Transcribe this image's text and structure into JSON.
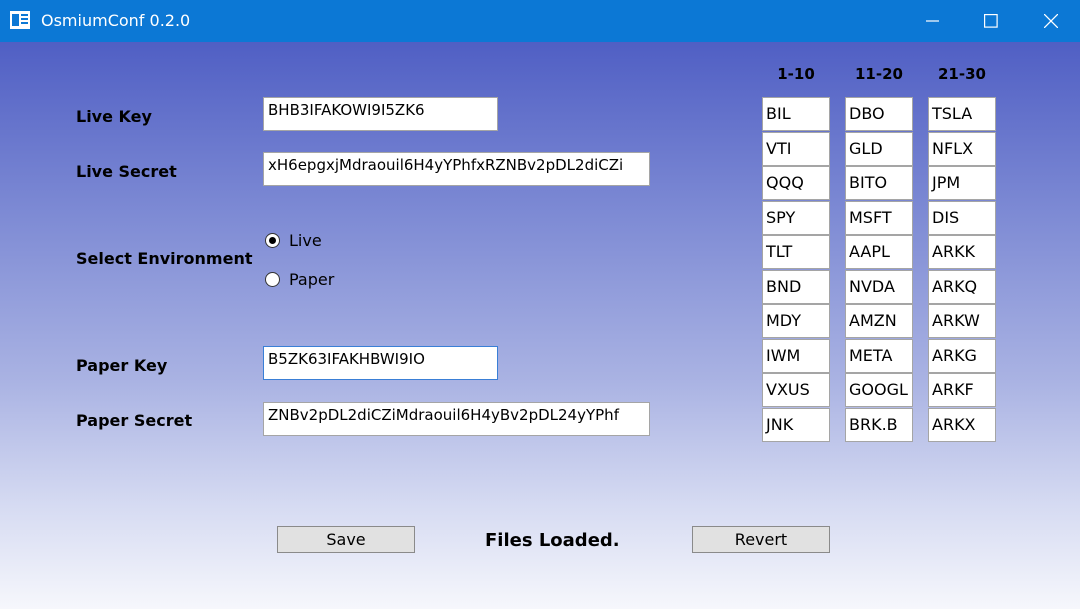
{
  "window": {
    "title": "OsmiumConf 0.2.0",
    "icons": [
      "app-icon",
      "minimize-icon",
      "maximize-icon",
      "close-icon"
    ],
    "titlebar_color": "#0c78d5"
  },
  "form": {
    "live_key_label": "Live Key",
    "live_key_value": "BHB3IFAKOWI9I5ZK6",
    "live_secret_label": "Live Secret",
    "live_secret_value": "xH6epgxjMdraouil6H4yYPhfxRZNBv2pDL2diCZi",
    "env_label": "Select Environment",
    "env_options": [
      "Live",
      "Paper"
    ],
    "env_selected": "Live",
    "paper_key_label": "Paper Key",
    "paper_key_value": "B5ZK63IFAKHBWI9IO",
    "paper_secret_label": "Paper Secret",
    "paper_secret_value": "ZNBv2pDL2diCZiMdraouil6H4yBv2pDL24yYPhf"
  },
  "tickers": {
    "columns": [
      {
        "header": "1-10",
        "values": [
          "BIL",
          "VTI",
          "QQQ",
          "SPY",
          "TLT",
          "BND",
          "MDY",
          "IWM",
          "VXUS",
          "JNK"
        ]
      },
      {
        "header": "11-20",
        "values": [
          "DBO",
          "GLD",
          "BITO",
          "MSFT",
          "AAPL",
          "NVDA",
          "AMZN",
          "META",
          "GOOGL",
          "BRK.B"
        ]
      },
      {
        "header": "21-30",
        "values": [
          "TSLA",
          "NFLX",
          "JPM",
          "DIS",
          "ARKK",
          "ARKQ",
          "ARKW",
          "ARKG",
          "ARKF",
          "ARKX"
        ]
      }
    ]
  },
  "footer": {
    "save_label": "Save",
    "status_text": "Files Loaded.",
    "revert_label": "Revert"
  }
}
